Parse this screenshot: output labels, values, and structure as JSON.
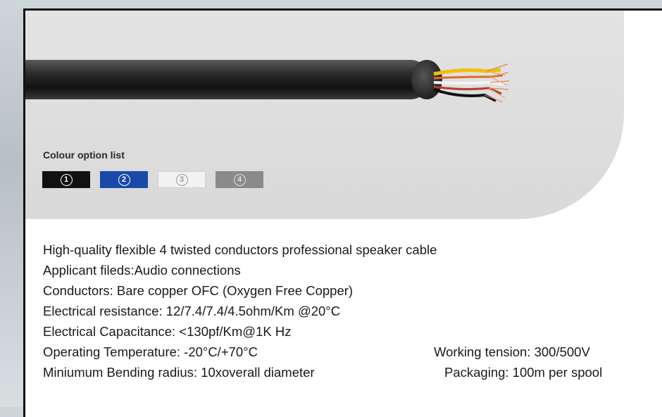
{
  "colour_options": {
    "title": "Colour option list",
    "swatches": [
      {
        "number": "1",
        "background": "#111111",
        "text_color": "#ffffff"
      },
      {
        "number": "2",
        "background": "#1a4aa8",
        "text_color": "#ffffff"
      },
      {
        "number": "3",
        "background": "#f2f2f2",
        "text_color": "#9a9a9a"
      },
      {
        "number": "4",
        "background": "#8a8a8a",
        "text_color": "#e0e0e0"
      }
    ]
  },
  "specs": {
    "line1": "High-quality flexible 4 twisted conductors professional speaker cable",
    "line2": "Applicant fileds:Audio connections",
    "line3": "Conductors: Bare copper OFC (Oxygen Free Copper)",
    "line4": "Electrical resistance: 12/7.4/7.4/4.5ohm/Km @20°C",
    "line5": "Electrical Capacitance: <130pf/Km@1K Hz",
    "line6_left": "Operating Temperature: -20°C/+70°C",
    "line6_right": "Working tension: 300/500V",
    "line7_left": "Miniumum Bending radius: 10xoverall diameter",
    "line7_right": "Packaging: 100m per spool"
  }
}
